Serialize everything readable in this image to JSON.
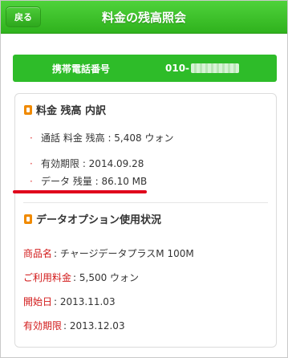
{
  "header": {
    "title": "料金の残高照会",
    "back_label": "戻る"
  },
  "phone": {
    "label": "携帯電話番号",
    "value_prefix": "010-"
  },
  "balance_section": {
    "title": "料金 残高 内訳",
    "items": [
      "通話 料金 残高 : 5,408 ウォン",
      "有効期限 : 2014.09.28",
      "データ 残量 : 86.10 MB"
    ]
  },
  "data_option_section": {
    "title": "データオプション使用状況",
    "rows": [
      {
        "key": "商品名",
        "value": " : チャージデータプラスM 100M"
      },
      {
        "key": "ご利用料金",
        "value": " : 5,500 ウォン"
      },
      {
        "key": "開始日",
        "value": " : 2013.11.03"
      },
      {
        "key": "有効期限",
        "value": " : 2013.12.03"
      }
    ]
  },
  "colors": {
    "header_green": "#36bf21",
    "phone_bar_green": "#2ebc29",
    "highlight_red": "#e0001b",
    "icon_orange": "#f08a00"
  },
  "icons": {
    "back": "back-arrow-button",
    "section_marker": "orange-tag-icon"
  }
}
